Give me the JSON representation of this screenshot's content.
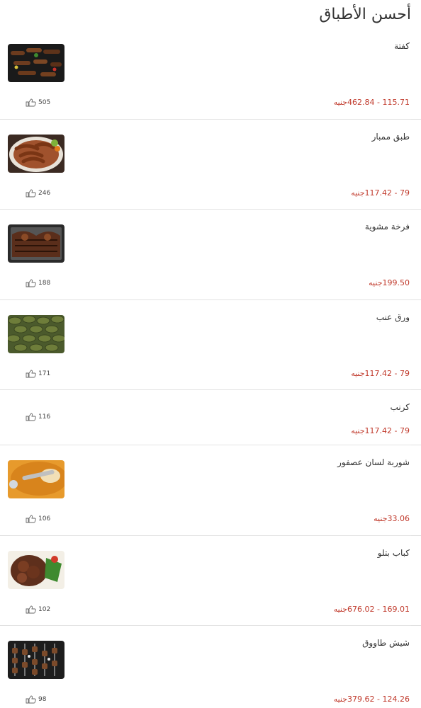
{
  "header": {
    "title": "أحسن الأطباق"
  },
  "dishes": [
    {
      "name": "كفتة",
      "price_range": "115.71 - 462.84",
      "currency": "جنيه",
      "likes": "505",
      "image_icon": "kofta-photo",
      "has_image": true
    },
    {
      "name": "طبق ممبار",
      "price_range": "79 - 117.42",
      "currency": "جنيه",
      "likes": "246",
      "image_icon": "mombar-photo",
      "has_image": true
    },
    {
      "name": "فرخة مشوية",
      "price_range": "199.50",
      "currency": "جنيه",
      "likes": "188",
      "image_icon": "grilled-chicken-photo",
      "has_image": true
    },
    {
      "name": "ورق عنب",
      "price_range": "79 - 117.42",
      "currency": "جنيه",
      "likes": "171",
      "image_icon": "vine-leaves-photo",
      "has_image": true
    },
    {
      "name": "كرنب",
      "price_range": "79 - 117.42",
      "currency": "جنيه",
      "likes": "116",
      "image_icon": "",
      "has_image": false
    },
    {
      "name": "شوربة لسان عصفور",
      "price_range": "33.06",
      "currency": "جنيه",
      "likes": "106",
      "image_icon": "orzo-soup-photo",
      "has_image": true
    },
    {
      "name": "كباب بتلو",
      "price_range": "169.01 - 676.02",
      "currency": "جنيه",
      "likes": "102",
      "image_icon": "veal-kebab-photo",
      "has_image": true
    },
    {
      "name": "شيش طاووق",
      "price_range": "124.26 - 379.62",
      "currency": "جنيه",
      "likes": "98",
      "image_icon": "shish-tawook-photo",
      "has_image": true
    }
  ],
  "colors": {
    "price": "#c0392b",
    "text": "#333333",
    "divider": "#e0e0e0"
  },
  "like_icon": "thumbs-up-icon"
}
